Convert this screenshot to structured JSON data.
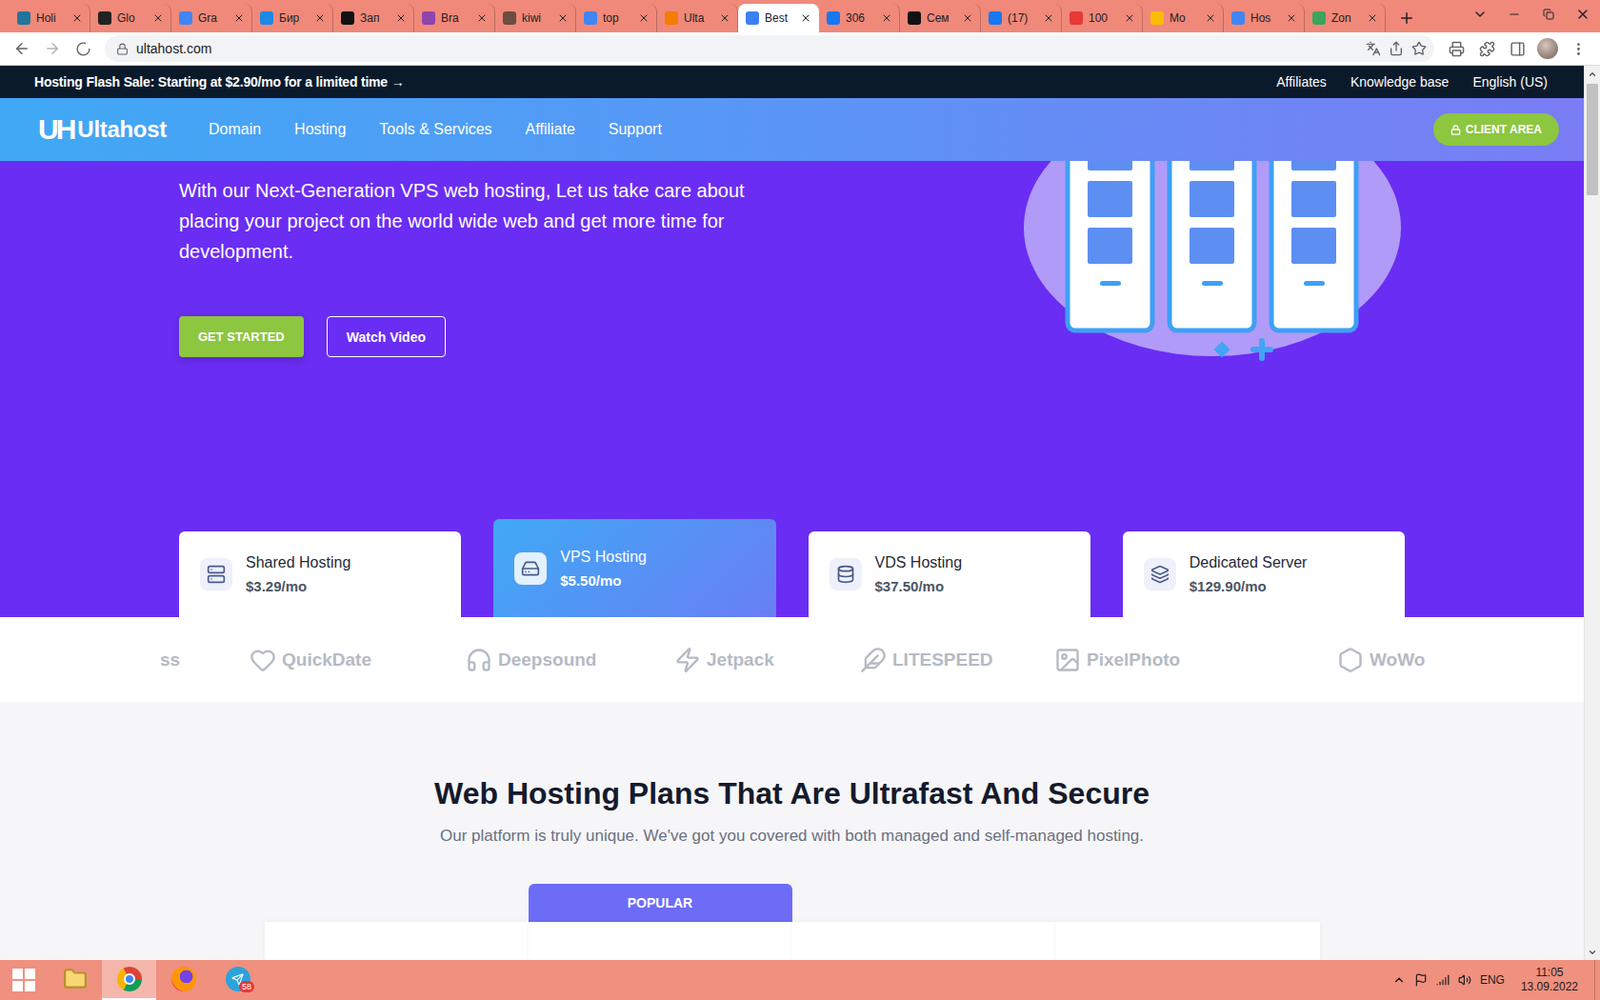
{
  "tabs": [
    {
      "label": "Holi",
      "selected": false,
      "color": "#21759b"
    },
    {
      "label": "Glo",
      "selected": false,
      "color": "#222222"
    },
    {
      "label": "Gra",
      "selected": false,
      "color": "#4285f4"
    },
    {
      "label": "Бир",
      "selected": false,
      "color": "#1e88e5"
    },
    {
      "label": "Зап",
      "selected": false,
      "color": "#111111"
    },
    {
      "label": "Bra",
      "selected": false,
      "color": "#8e44ad"
    },
    {
      "label": "kiwi",
      "selected": false,
      "color": "#6d4c41"
    },
    {
      "label": "top",
      "selected": false,
      "color": "#4285f4"
    },
    {
      "label": "Ulta",
      "selected": false,
      "color": "#f57c00"
    },
    {
      "label": "Best",
      "selected": true,
      "color": "#3d7ff5"
    },
    {
      "label": "306",
      "selected": false,
      "color": "#1877f2"
    },
    {
      "label": "Сем",
      "selected": false,
      "color": "#111111"
    },
    {
      "label": "(17)",
      "selected": false,
      "color": "#1877f2"
    },
    {
      "label": "100",
      "selected": false,
      "color": "#e53935"
    },
    {
      "label": "Mo",
      "selected": false,
      "color": "#fbbc04"
    },
    {
      "label": "Hos",
      "selected": false,
      "color": "#4285f4"
    },
    {
      "label": "Zon",
      "selected": false,
      "color": "#3ba55c"
    }
  ],
  "address_bar": {
    "url": "ultahost.com"
  },
  "promo_bar": {
    "text": "Hosting Flash Sale: Starting at $2.90/mo for a limited time →",
    "links": [
      "Affiliates",
      "Knowledge base",
      "English (US)"
    ]
  },
  "nav": {
    "logo_mark": "UH",
    "logo": "Ultahost",
    "items": [
      "Domain",
      "Hosting",
      "Tools & Services",
      "Affiliate",
      "Support"
    ],
    "button": "CLIENT AREA"
  },
  "hero": {
    "text": "With our Next-Generation VPS web hosting, Let us take care about placing your project on the world wide web and get more time for development.",
    "buttons": [
      "GET STARTED",
      "Watch Video"
    ],
    "cards": [
      {
        "title": "Shared Hosting",
        "price": "$3.29/mo",
        "selected": false
      },
      {
        "title": "VPS Hosting",
        "price": "$5.50/mo",
        "selected": true
      },
      {
        "title": "VDS Hosting",
        "price": "$37.50/mo",
        "selected": false
      },
      {
        "title": "Dedicated Server",
        "price": "$129.90/mo",
        "selected": false
      }
    ]
  },
  "partners": [
    {
      "name": "ss",
      "kind": "text"
    },
    {
      "name": "QuickDate",
      "kind": "logo"
    },
    {
      "name": "Deepsound",
      "kind": "logo"
    },
    {
      "name": "Jetpack",
      "kind": "logo"
    },
    {
      "name": "LITESPEED",
      "kind": "logo"
    },
    {
      "name": "PixelPhoto",
      "kind": "logo"
    },
    {
      "name": "WoWo",
      "kind": "logo"
    }
  ],
  "plans": {
    "title": "Web Hosting Plans That Are Ultrafast And Secure",
    "subtitle": "Our platform is truly unique. We've got you covered with both managed and self-managed hosting.",
    "badge": "POPULAR",
    "columns": [
      {
        "popular": false
      },
      {
        "popular": true
      },
      {
        "popular": false
      },
      {
        "popular": false
      }
    ]
  },
  "scrollbar": {
    "level": 0.13
  },
  "taskbar": {
    "apps": [
      {
        "kind": "explorer",
        "selected": false
      },
      {
        "kind": "chrome",
        "selected": true
      },
      {
        "kind": "firefox",
        "selected": false
      },
      {
        "kind": "telegram",
        "selected": false,
        "badge": "58"
      }
    ],
    "language": "ENG",
    "time": "11:05",
    "date": "13.09.2022"
  }
}
